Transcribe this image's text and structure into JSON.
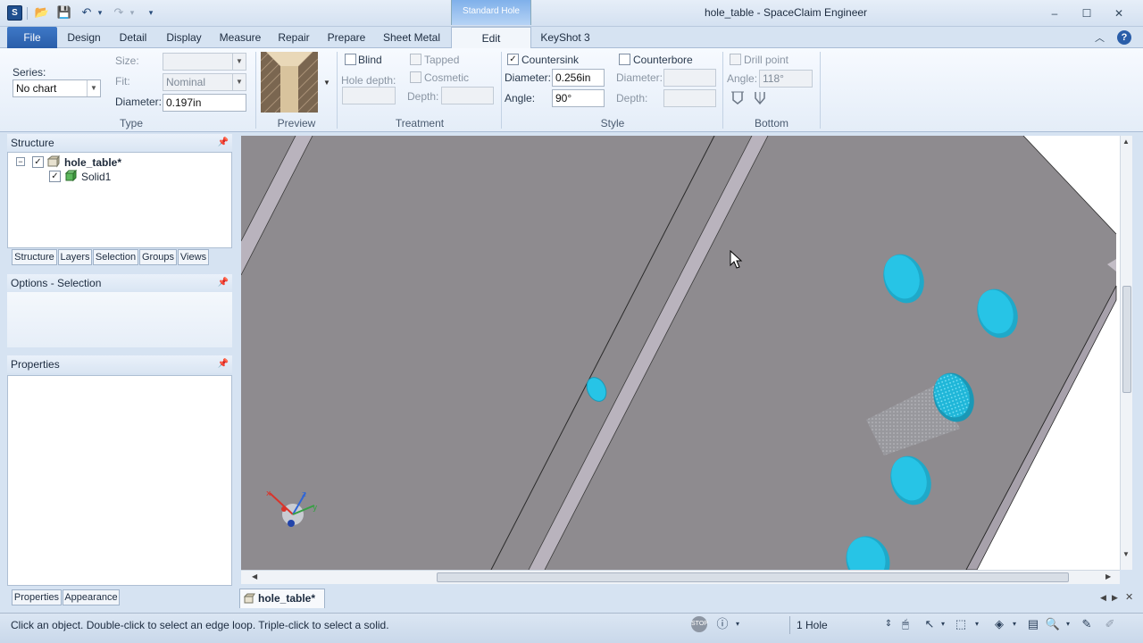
{
  "window": {
    "title": "hole_table - SpaceClaim Engineer",
    "context_tab_header": "Standard Hole",
    "controls": {
      "minimize": "–",
      "maximize": "☐",
      "close": "✕"
    }
  },
  "quick_access": {
    "open": "📂",
    "save": "💾",
    "undo": "↶",
    "redo": "↷",
    "more": "▾"
  },
  "ribbon_tabs": [
    "File",
    "Design",
    "Detail",
    "Display",
    "Measure",
    "Repair",
    "Prepare",
    "Sheet Metal",
    "Edit",
    "KeyShot 3"
  ],
  "ribbon": {
    "type_group": {
      "label": "Type",
      "series_label": "Series:",
      "series_value": "No chart",
      "size_label": "Size:",
      "size_value": "",
      "fit_label": "Fit:",
      "fit_value": "Nominal",
      "diameter_label": "Diameter:",
      "diameter_value": "0.197in"
    },
    "preview_group": {
      "label": "Preview"
    },
    "treatment_group": {
      "label": "Treatment",
      "blind": "Blind",
      "tapped": "Tapped",
      "cosmetic": "Cosmetic",
      "hole_depth_label": "Hole depth:",
      "depth_label": "Depth:"
    },
    "style_group": {
      "label": "Style",
      "countersink": "Countersink",
      "counterbore": "Counterbore",
      "cs_diameter_label": "Diameter:",
      "cs_diameter_value": "0.256in",
      "cs_angle_label": "Angle:",
      "cs_angle_value": "90°",
      "cb_diameter_label": "Diameter:",
      "cb_depth_label": "Depth:"
    },
    "bottom_group": {
      "label": "Bottom",
      "drill_point": "Drill point",
      "angle_label": "Angle:",
      "angle_value": "118°"
    }
  },
  "structure_panel": {
    "title": "Structure",
    "root": "hole_table*",
    "child": "Solid1",
    "tabs": [
      "Structure",
      "Layers",
      "Selection",
      "Groups",
      "Views"
    ]
  },
  "options_panel": {
    "title": "Options - Selection"
  },
  "properties_panel": {
    "title": "Properties",
    "tabs": [
      "Properties",
      "Appearance"
    ]
  },
  "document_tab": {
    "label": "hole_table*",
    "close": "✕"
  },
  "status": {
    "message": "Click an object. Double-click to select an edge loop. Triple-click to select a solid.",
    "selection_count": "1 Hole"
  },
  "colors": {
    "accent": "#2a5ea9",
    "model_face": "#8e8b8f",
    "hole": "#27c4e6",
    "edge_strip": "#b9b3bd"
  }
}
